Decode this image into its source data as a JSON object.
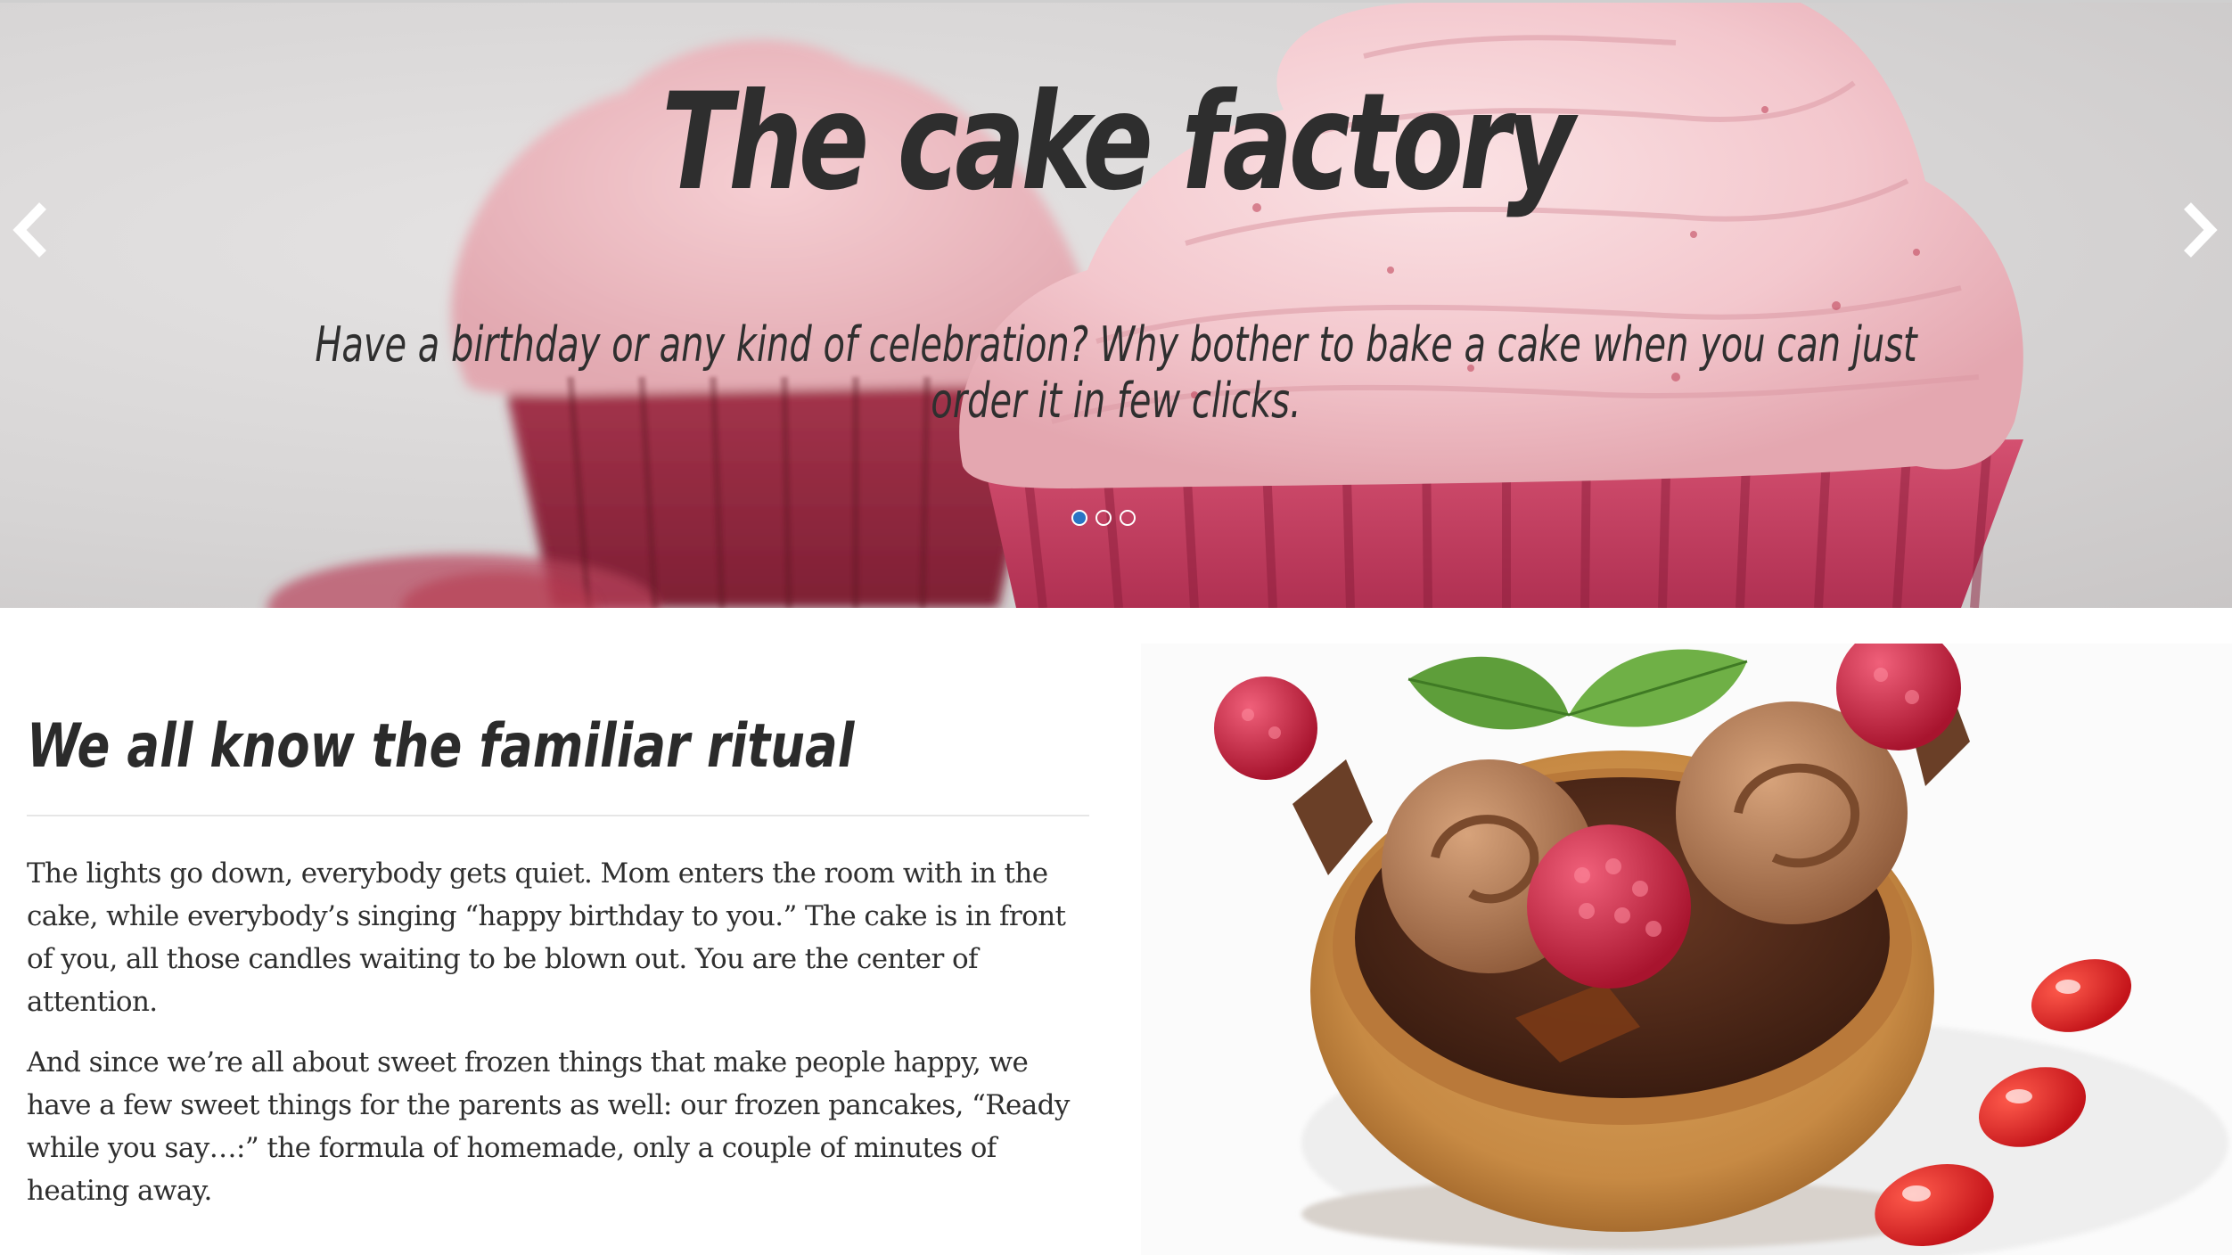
{
  "hero": {
    "title": "The cake factory",
    "subtitle": "Have a birthday or any kind of celebration? Why bother to bake a cake when you can just order it in few clicks.",
    "prev_icon": "chevron-left-icon",
    "next_icon": "chevron-right-icon",
    "slides_total": 3,
    "active_slide": 1,
    "accent_color": "#2a74c4"
  },
  "content": {
    "heading": "We all know the familiar ritual",
    "paragraph_1": "The lights go down, everybody gets quiet. Mom enters the room with in the cake, while everybody’s singing “happy birthday to you.” The cake is in front of you, all those candles waiting to be blown out. You are the center of attention.",
    "paragraph_2": "And since we’re all about sweet frozen things that make people happy, we have a few sweet things for the parents as well: our frozen pancakes, “Ready while you say…:” the formula of homemade, only a couple of minutes of heating away."
  }
}
